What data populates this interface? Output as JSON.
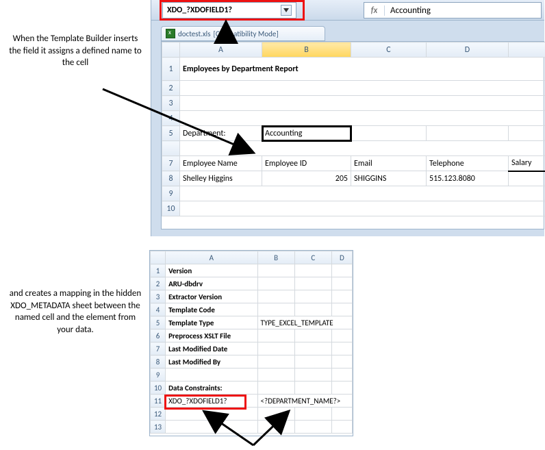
{
  "captions": {
    "top": "When the Template Builder inserts the field it assigns a defined name to the cell",
    "mid": "and creates a mapping in the hidden XDO_METADATA sheet between the named cell and the element from your data."
  },
  "namebox": {
    "value": "XDO_?XDOFIELD1?"
  },
  "formula_bar": {
    "label": "fx",
    "value": "Accounting"
  },
  "workbook": {
    "filename": "doctest.xls",
    "mode": "[Compatibility Mode]"
  },
  "sheet1": {
    "columns": [
      "A",
      "B",
      "C",
      "D"
    ],
    "extra_col": "",
    "rows": [
      "1",
      "2",
      "3",
      "4",
      "5",
      "",
      "7",
      "8",
      "9",
      "10"
    ],
    "title": "Employees by Department Report",
    "dept_label": "Department:",
    "dept_value": "Accounting",
    "headers": {
      "a": "Employee Name",
      "b": "Employee ID",
      "c": "Email",
      "d": "Telephone",
      "e": "Salary"
    },
    "row8": {
      "a": "Shelley Higgins",
      "b": "205",
      "c": "SHIGGINS",
      "d": "515.123.8080"
    }
  },
  "sheet2": {
    "columns": [
      "A",
      "B",
      "C",
      "D"
    ],
    "rows": [
      "1",
      "2",
      "3",
      "4",
      "5",
      "6",
      "7",
      "8",
      "9",
      "10",
      "11",
      "12",
      "13"
    ],
    "data": {
      "r1a": "Version",
      "r2a": "ARU-dbdrv",
      "r3a": "Extractor Version",
      "r4a": "Template Code",
      "r5a": "Template Type",
      "r5b": "TYPE_EXCEL_TEMPLATE",
      "r6a": "Preprocess XSLT File",
      "r7a": "Last Modified Date",
      "r8a": "Last Modified By",
      "r10a": "Data Constraints:",
      "r11a": "XDO_?XDOFIELD1?",
      "r11b": "<?DEPARTMENT_NAME?>"
    }
  }
}
